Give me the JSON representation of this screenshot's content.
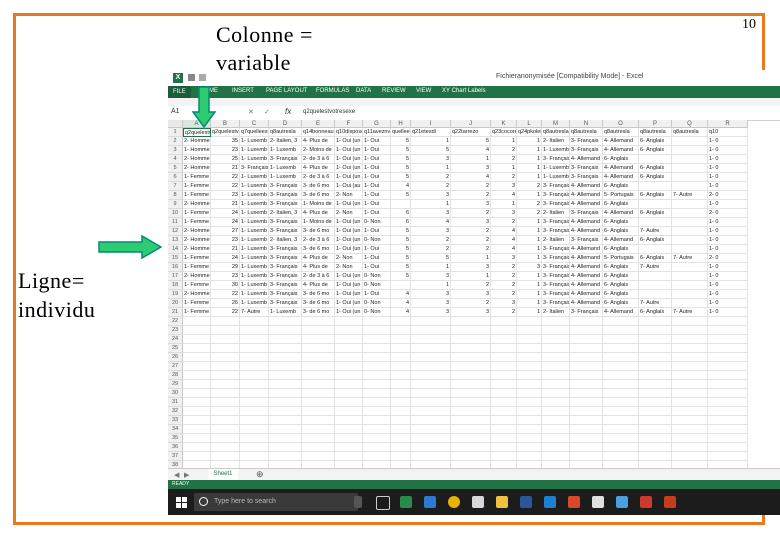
{
  "slide": {
    "page_number": "10",
    "title_line1": "Colonne =",
    "title_line2": "variable",
    "side_line1": "Ligne=",
    "side_line2": "individu"
  },
  "excel": {
    "window_title": "Fichieranonymisée  [Compatibility Mode] - Excel",
    "ribbon_tabs": [
      "FILE",
      "HOME",
      "INSERT",
      "PAGE LAYOUT",
      "FORMULAS",
      "DATA",
      "REVIEW",
      "VIEW",
      "XY Chart Labels"
    ],
    "name_box": "A1",
    "formula": "q2quelestvotresexe",
    "columns": [
      "A",
      "B",
      "C",
      "D",
      "E",
      "F",
      "G",
      "H",
      "I",
      "J",
      "K",
      "L",
      "M",
      "N",
      "O",
      "P",
      "Q",
      "R"
    ],
    "header_row": [
      "q2quelestvo",
      "q2quelestvo",
      "q7quelleest",
      "q8autresla",
      "q14bonneaux",
      "q10dispose",
      "q11aveznv",
      "quelleestvo",
      "q21etesdi",
      "q22tarrezo",
      "q23cocoreu",
      "q24pkoleidc",
      "q8autresla",
      "q8autresla",
      "q8autresla",
      "q8autresla",
      "q8autresla",
      "q10"
    ],
    "rows": [
      [
        "2- Homme",
        "35",
        "1- Luxemb",
        "2- Italien, 3",
        "4- Plus de",
        "1- Oui (un",
        "1- Oui",
        "5",
        "1",
        "5",
        "1",
        "1",
        "2- Italien",
        "3- Français",
        "4- Allemand",
        "6- Anglais",
        "",
        "1- 0"
      ],
      [
        "1- Homme",
        "23",
        "1- Luxemb",
        "1- Luxemb",
        "2- Moins de",
        "1- Oui (un",
        "1- Oui",
        "5",
        "5",
        "4",
        "2",
        "1",
        "1- Luxemb",
        "3- Français",
        "4- Allemand",
        "6- Anglais",
        "",
        "1- 0"
      ],
      [
        "2- Homme",
        "25",
        "1- Luxemb",
        "3- Français",
        "2- de 3 à 6",
        "1- Oui (un",
        "1- Oui",
        "5",
        "3",
        "1",
        "2",
        "1",
        "3- Français",
        "4- Allemand",
        "6- Anglais",
        "",
        "",
        "1- 0"
      ],
      [
        "2- Homme",
        "21",
        "3- Français",
        "1- Luxemb",
        "4- Plus de",
        "1- Oui (un",
        "1- Oui",
        "5",
        "1",
        "3",
        "1",
        "1",
        "1- Luxemb",
        "3- Français",
        "4- Allemand",
        "6- Anglais",
        "",
        "1- 0"
      ],
      [
        "1- Femme",
        "22",
        "1- Luxemb",
        "1- Luxemb",
        "2- de 3 à 6",
        "1- Oui (un",
        "1- Oui",
        "5",
        "2",
        "4",
        "2",
        "1",
        "1- Luxemb",
        "3- Français",
        "4- Allemand",
        "6- Anglais",
        "",
        "1- 0"
      ],
      [
        "1- Femme",
        "22",
        "1- Luxemb",
        "3- Français",
        "3- de 6 mo",
        "1- Oui (au",
        "1- Oui",
        "4",
        "2",
        "2",
        "3",
        "2",
        "3- Français",
        "4- Allemand",
        "6- Anglais",
        "",
        "",
        "1- 0"
      ],
      [
        "1- Femme",
        "23",
        "1- Luxemb",
        "3- Français",
        "3- de 6 mo",
        "2- Non",
        "1- Oui",
        "5",
        "3",
        "2",
        "4",
        "1",
        "3- Français",
        "4- Allemand",
        "5- Portugais",
        "6- Anglais",
        "7- Autre",
        "2- 0"
      ],
      [
        "2- Homme",
        "21",
        "1- Luxemb",
        "3- Français",
        "1- Moins de",
        "1- Oui (un",
        "1- Oui",
        "",
        "1",
        "3",
        "1",
        "2",
        "3- Français",
        "4- Allemand",
        "6- Anglais",
        "",
        "",
        "1- 0"
      ],
      [
        "1- Femme",
        "24",
        "1- Luxemb",
        "2- Italien, 3",
        "4- Plus de",
        "2- Non",
        "1- Oui",
        "6",
        "3",
        "2",
        "3",
        "2",
        "2- Italien",
        "3- Français",
        "4- Allemand",
        "6- Anglais",
        "",
        "2- 0"
      ],
      [
        "1- Femme",
        "24",
        "1- Luxemb",
        "3- Français",
        "1- Moins de",
        "1- Oui (un",
        "0- Non",
        "6",
        "4",
        "3",
        "2",
        "1",
        "3- Français",
        "4- Allemand",
        "6- Anglais",
        "",
        "",
        "1- 0"
      ],
      [
        "2- Homme",
        "27",
        "1- Luxemb",
        "3- Français",
        "3- de 6 mo",
        "1- Oui (un",
        "1- Oui",
        "5",
        "3",
        "2",
        "4",
        "1",
        "3- Français",
        "4- Allemand",
        "6- Anglais",
        "7- Autre",
        "",
        "1- 0"
      ],
      [
        "2- Homme",
        "23",
        "1- Luxemb",
        "2- Italien, 3",
        "2- de 3 à 6",
        "1- Oui (un",
        "0- Non",
        "5",
        "2",
        "2",
        "4",
        "1",
        "2- Italien",
        "3- Français",
        "4- Allemand",
        "6- Anglais",
        "",
        "1- 0"
      ],
      [
        "2- Homme",
        "21",
        "1- Luxemb",
        "3- Français",
        "3- de 6 mo",
        "1- Oui (un",
        "1- Oui",
        "5",
        "2",
        "2",
        "4",
        "1",
        "3- Français",
        "4- Allemand",
        "6- Anglais",
        "",
        "",
        "1- 0"
      ],
      [
        "1- Femme",
        "24",
        "1- Luxemb",
        "3- Français",
        "4- Plus de",
        "2- Non",
        "1- Oui",
        "5",
        "5",
        "1",
        "3",
        "1",
        "3- Français",
        "4- Allemand",
        "5- Portugais",
        "6- Anglais",
        "7- Autre",
        "2- 0"
      ],
      [
        "1- Femme",
        "29",
        "1- Luxemb",
        "3- Français",
        "4- Plus de",
        "2- Non",
        "1- Oui",
        "5",
        "1",
        "3",
        "2",
        "3",
        "3- Français",
        "4- Allemand",
        "6- Anglais",
        "7- Autre",
        "",
        "1- 0"
      ],
      [
        "2- Homme",
        "23",
        "1- Luxemb",
        "3- Français",
        "2- de 3 à 6",
        "1- Oui (un",
        "0- Non",
        "5",
        "3",
        "1",
        "2",
        "1",
        "3- Français",
        "4- Allemand",
        "6- Anglais",
        "",
        "",
        "1- 0"
      ],
      [
        "1- Femme",
        "30",
        "1- Luxemb",
        "3- Français",
        "4- Plus de",
        "1- Oui (un",
        "0- Non",
        "",
        "1",
        "2",
        "2",
        "1",
        "3- Français",
        "4- Allemand",
        "6- Anglais",
        "",
        "",
        "1- 0"
      ],
      [
        "2- Homme",
        "22",
        "1- Luxemb",
        "3- Français",
        "3- de 6 mo",
        "1- Oui (un",
        "1- Oui",
        "4",
        "3",
        "3",
        "2",
        "1",
        "3- Français",
        "4- Allemand",
        "6- Anglais",
        "",
        "",
        "1- 0"
      ],
      [
        "1- Femme",
        "26",
        "1- Luxemb",
        "3- Français",
        "3- de 6 mo",
        "1- Oui (un",
        "0- Non",
        "4",
        "3",
        "2",
        "3",
        "1",
        "3- Français",
        "4- Allemand",
        "6- Anglais",
        "7- Autre",
        "",
        "1- 0"
      ],
      [
        "1- Femme",
        "22",
        "7- Autre",
        "1- Luxemb",
        "3- de 6 mo",
        "1- Oui (un",
        "0- Non",
        "4",
        "3",
        "3",
        "2",
        "1",
        "2- Italien",
        "3- Français",
        "4- Allemand",
        "6- Anglais",
        "7- Autre",
        "1- 0"
      ]
    ],
    "empty_row_numbers": [
      "22",
      "23",
      "24",
      "25",
      "26",
      "27",
      "28",
      "29",
      "30",
      "31",
      "32",
      "33",
      "34",
      "35",
      "36",
      "37",
      "38"
    ],
    "sheet_tab": "Sheet1",
    "status": "READY"
  },
  "taskbar": {
    "search_placeholder": "Type here to search"
  }
}
